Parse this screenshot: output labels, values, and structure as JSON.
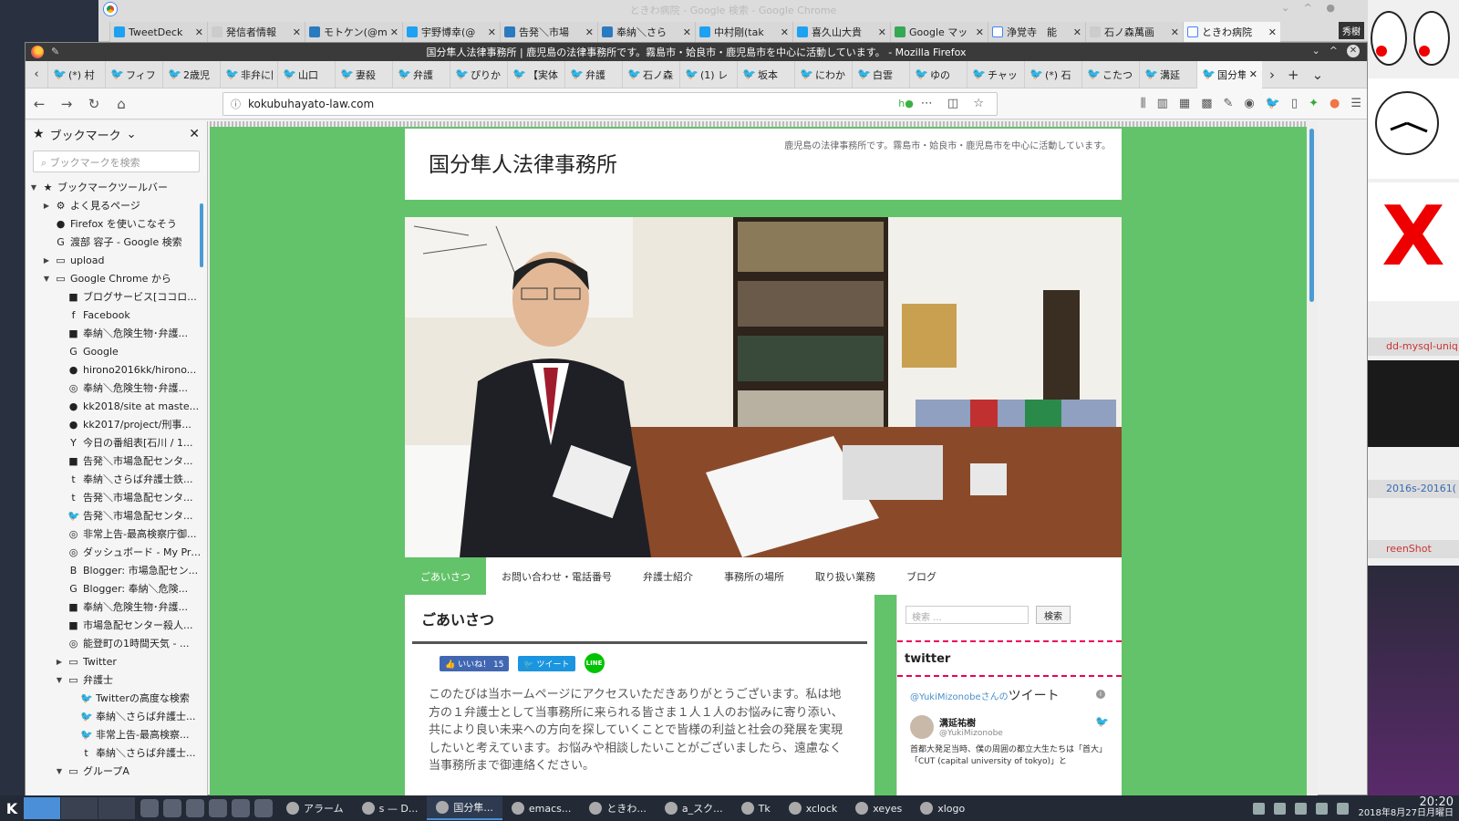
{
  "chrome": {
    "title": "ときわ病院 - Google 検索 - Google Chrome",
    "user": "秀樹",
    "tabs": [
      {
        "label": "TweetDeck"
      },
      {
        "label": "発信者情報"
      },
      {
        "label": "モトケン(@m"
      },
      {
        "label": "宇野博幸(@"
      },
      {
        "label": "告発＼市場"
      },
      {
        "label": "奉納＼さら"
      },
      {
        "label": "中村剛(tak"
      },
      {
        "label": "喜久山大貴"
      },
      {
        "label": "Google マッ"
      },
      {
        "label": "浄覚寺　能"
      },
      {
        "label": "石ノ森萬画"
      },
      {
        "label": "ときわ病院"
      }
    ]
  },
  "firefox": {
    "title": "国分隼人法律事務所 | 鹿児島の法律事務所です。霧島市・姶良市・鹿児島市を中心に活動しています。 - Mozilla Firefox",
    "url": "kokubuhayato-law.com",
    "tabs": [
      {
        "label": "(*) 村"
      },
      {
        "label": "フィフ"
      },
      {
        "label": "2歳児"
      },
      {
        "label": "非弁に関"
      },
      {
        "label": "山口"
      },
      {
        "label": "妻殺"
      },
      {
        "label": "弁護"
      },
      {
        "label": "ぴりか"
      },
      {
        "label": "【実体"
      },
      {
        "label": "弁護"
      },
      {
        "label": "石ノ森"
      },
      {
        "label": "(1) レ"
      },
      {
        "label": "坂本"
      },
      {
        "label": "にわか"
      },
      {
        "label": "白雲"
      },
      {
        "label": "ゆの"
      },
      {
        "label": "チャッ"
      },
      {
        "label": "(*) 石"
      },
      {
        "label": "こたつ"
      },
      {
        "label": "溝延"
      },
      {
        "label": "国分隼"
      }
    ]
  },
  "sidebar": {
    "title": "ブックマーク",
    "search_placeholder": "ブックマークを検索",
    "items": [
      {
        "label": "ブックマークツールバー",
        "level": 0,
        "twisty": "▼",
        "icon": "★"
      },
      {
        "label": "よく見るページ",
        "level": 1,
        "twisty": "▶",
        "icon": "⚙"
      },
      {
        "label": "Firefox を使いこなそう",
        "level": 1,
        "twisty": "",
        "icon": "●"
      },
      {
        "label": "渡部 容子 - Google 検索",
        "level": 1,
        "twisty": "",
        "icon": "G"
      },
      {
        "label": "upload",
        "level": 1,
        "twisty": "▶",
        "icon": "▭"
      },
      {
        "label": "Google Chrome から",
        "level": 1,
        "twisty": "▼",
        "icon": "▭"
      },
      {
        "label": "ブログサービス[ココロ...",
        "level": 2,
        "twisty": "",
        "icon": "■"
      },
      {
        "label": "Facebook",
        "level": 2,
        "twisty": "",
        "icon": "f"
      },
      {
        "label": "奉納＼危険生物･弁護...",
        "level": 2,
        "twisty": "",
        "icon": "■"
      },
      {
        "label": "Google",
        "level": 2,
        "twisty": "",
        "icon": "G"
      },
      {
        "label": "hirono2016kk/hirono...",
        "level": 2,
        "twisty": "",
        "icon": "●"
      },
      {
        "label": "奉納＼危険生物･弁護...",
        "level": 2,
        "twisty": "",
        "icon": "◎"
      },
      {
        "label": "kk2018/site at maste...",
        "level": 2,
        "twisty": "",
        "icon": "●"
      },
      {
        "label": "kk2017/project/刑事...",
        "level": 2,
        "twisty": "",
        "icon": "●"
      },
      {
        "label": "今日の番組表[石川 / 1...",
        "level": 2,
        "twisty": "",
        "icon": "Y"
      },
      {
        "label": "告発＼市場急配センタ...",
        "level": 2,
        "twisty": "",
        "icon": "■"
      },
      {
        "label": "奉納＼さらば弁護士鉄...",
        "level": 2,
        "twisty": "",
        "icon": "t"
      },
      {
        "label": "告発＼市場急配センタ...",
        "level": 2,
        "twisty": "",
        "icon": "t"
      },
      {
        "label": "告発＼市場急配センタ...",
        "level": 2,
        "twisty": "",
        "icon": "🐦"
      },
      {
        "label": "非常上告-最高検察庁御...",
        "level": 2,
        "twisty": "",
        "icon": "◎"
      },
      {
        "label": "ダッシュボード - My Pro...",
        "level": 2,
        "twisty": "",
        "icon": "◎"
      },
      {
        "label": "Blogger: 市場急配セン...",
        "level": 2,
        "twisty": "",
        "icon": "B"
      },
      {
        "label": "Blogger: 奉納＼危険...",
        "level": 2,
        "twisty": "",
        "icon": "G"
      },
      {
        "label": "奉納＼危険生物･弁護...",
        "level": 2,
        "twisty": "",
        "icon": "■"
      },
      {
        "label": "市場急配センター殺人...",
        "level": 2,
        "twisty": "",
        "icon": "■"
      },
      {
        "label": "能登町の1時間天気 - ...",
        "level": 2,
        "twisty": "",
        "icon": "◎"
      },
      {
        "label": "Twitter",
        "level": 2,
        "twisty": "▶",
        "icon": "▭"
      },
      {
        "label": "弁護士",
        "level": 2,
        "twisty": "▼",
        "icon": "▭"
      },
      {
        "label": "Twitterの高度な検索",
        "level": 3,
        "twisty": "",
        "icon": "🐦"
      },
      {
        "label": "奉納＼さらば弁護士...",
        "level": 3,
        "twisty": "",
        "icon": "🐦"
      },
      {
        "label": "非常上告-最高検察...",
        "level": 3,
        "twisty": "",
        "icon": "🐦"
      },
      {
        "label": "奉納＼さらば弁護士...",
        "level": 3,
        "twisty": "",
        "icon": "t"
      },
      {
        "label": "グループA",
        "level": 2,
        "twisty": "▼",
        "icon": "▭"
      }
    ]
  },
  "site": {
    "name": "国分隼人法律事務所",
    "tagline": "鹿児島の法律事務所です。霧島市・姶良市・鹿児島市を中心に活動しています。",
    "menu": [
      {
        "label": "ごあいさつ",
        "active": true
      },
      {
        "label": "お問い合わせ・電話番号",
        "active": false
      },
      {
        "label": "弁護士紹介",
        "active": false
      },
      {
        "label": "事務所の場所",
        "active": false
      },
      {
        "label": "取り扱い業務",
        "active": false
      },
      {
        "label": "ブログ",
        "active": false
      }
    ],
    "page_title": "ごあいさつ",
    "like_label": "いいね！",
    "like_count": "15",
    "tweet_label": "ツイート",
    "line_label": "LINE",
    "intro": "このたびは当ホームページにアクセスいただきありがとうございます。私は地方の１弁護士として当事務所に来られる皆さま１人１人のお悩みに寄り添い、共により良い未来への方向を探していくことで皆様の利益と社会の発展を実現したいと考えています。お悩みや相談したいことがございましたら、遠慮なく当事務所まで御連絡ください。",
    "search_placeholder": "検索 ...",
    "search_button": "検索",
    "twitter_heading": "twitter",
    "tweets_from": "@YukiMizonobeさんの",
    "tweets_label": "ツイート",
    "tweet_author": "溝延祐樹",
    "tweet_handle": "@YukiMizonobe",
    "tweet_text": "首都大発足当時、僕の周囲の都立大生たちは「首大」「CUT (capital university of tokyo)」と"
  },
  "right_panel": {
    "strip1": "dd-mysql-uniq",
    "strip2": "2016s-20161(",
    "strip3": "reenShot",
    "xlogo": "X"
  },
  "taskbar": {
    "tasks": [
      {
        "label": "アラーム"
      },
      {
        "label": "s — D..."
      },
      {
        "label": "国分隼..."
      },
      {
        "label": "emacs..."
      },
      {
        "label": "ときわ..."
      },
      {
        "label": "a_スク..."
      },
      {
        "label": "Tk"
      },
      {
        "label": "xclock"
      },
      {
        "label": "xeyes"
      },
      {
        "label": "xlogo"
      }
    ],
    "time": "20:20",
    "date": "2018年8月27日月曜日"
  },
  "colors": {
    "site_green": "#63c36a",
    "accent_blue": "#4a9ad4"
  }
}
